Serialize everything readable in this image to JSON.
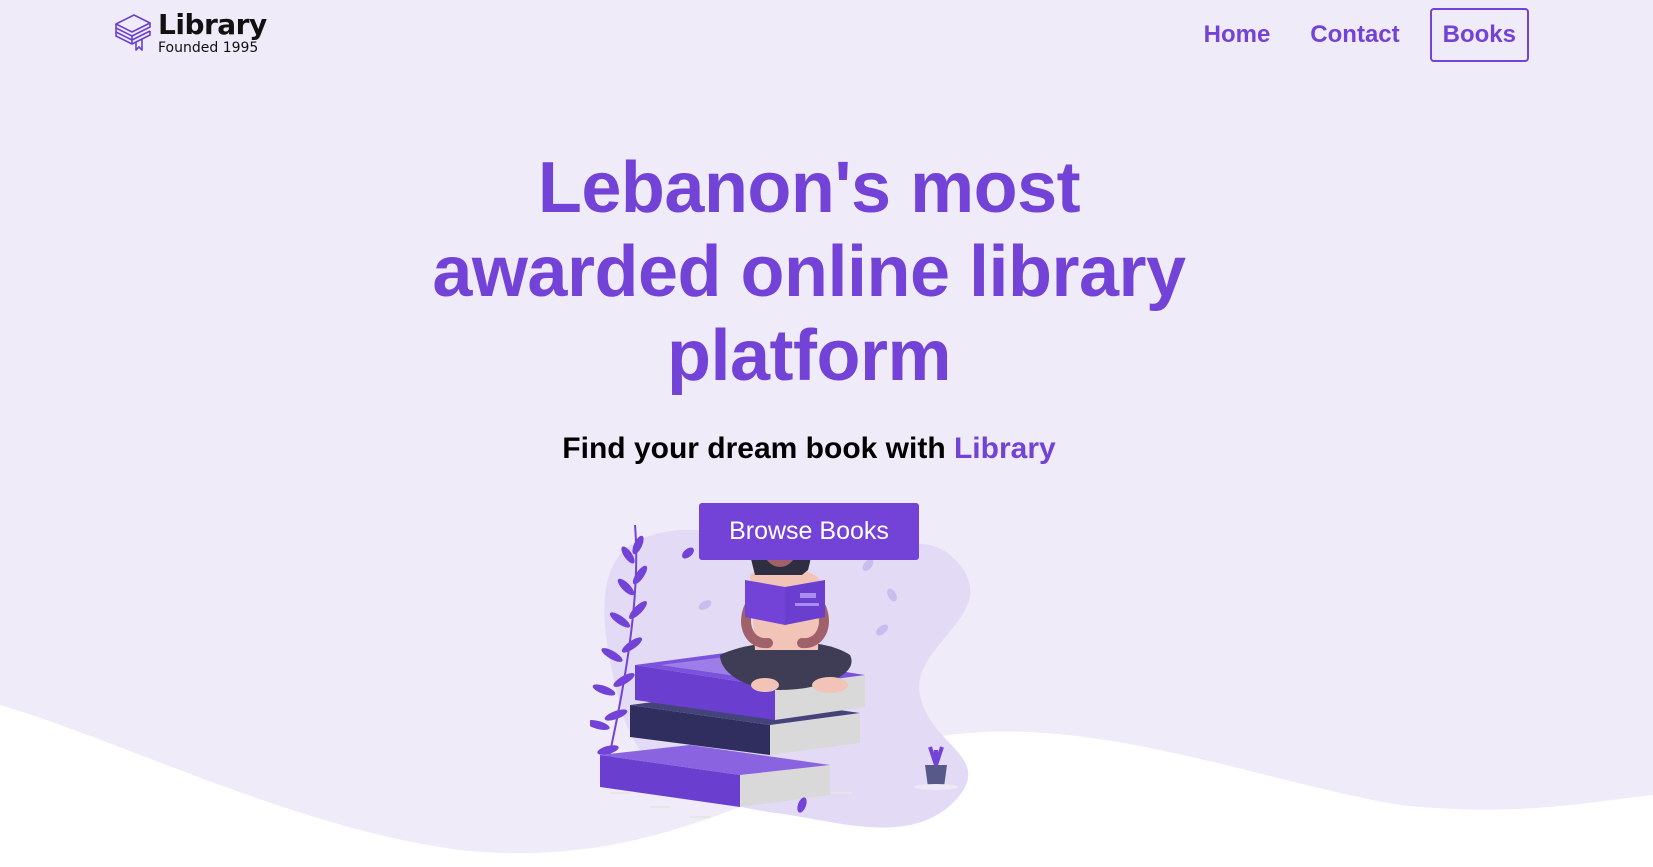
{
  "brand": {
    "title": "Library",
    "subtitle": "Founded 1995"
  },
  "nav": {
    "items": [
      {
        "label": "Home"
      },
      {
        "label": "Contact"
      },
      {
        "label": "Books"
      }
    ]
  },
  "hero": {
    "headline": "Lebanon's most awarded online library platform",
    "tagline_prefix": "Find your dream book with ",
    "tagline_accent": "Library",
    "cta_label": "Browse Books"
  },
  "colors": {
    "accent": "#7342d6",
    "background": "#efebf9",
    "dark_book": "#2f2e5f"
  },
  "icons": {
    "logo": "stacked-books-icon"
  }
}
